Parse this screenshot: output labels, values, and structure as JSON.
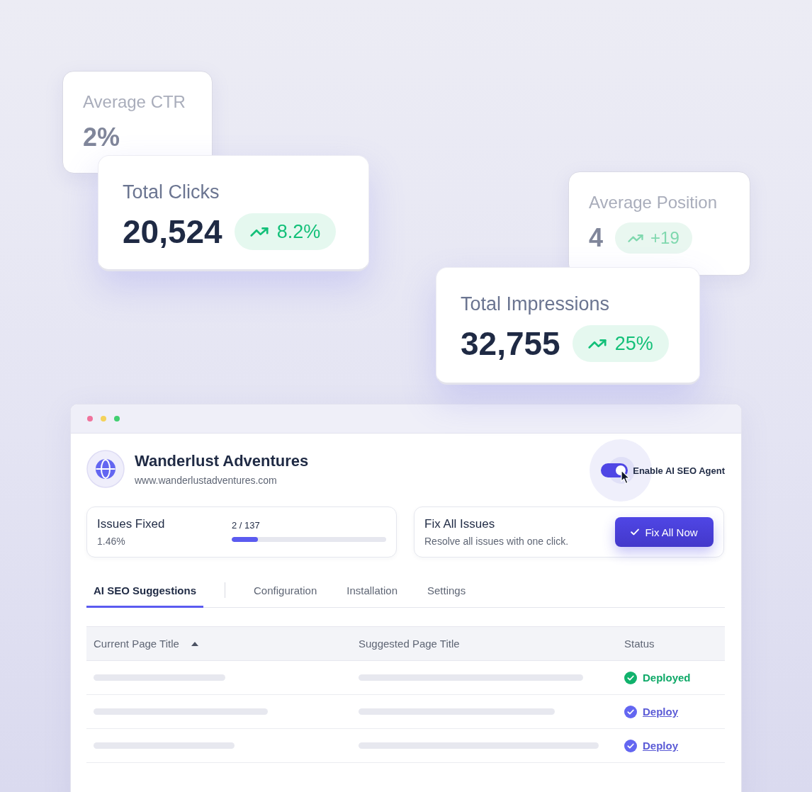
{
  "metrics": [
    {
      "label": "Average CTR",
      "value": "2%",
      "faded": true
    },
    {
      "label": "Total Clicks",
      "value": "20,524",
      "change": "8.2%",
      "rising": true,
      "faded": false
    },
    {
      "label": "Average Position",
      "value": "4",
      "change": "+19",
      "rising": true,
      "faded": true
    },
    {
      "label": "Total Impressions",
      "value": "32,755",
      "change": "25%",
      "rising": true,
      "faded": false
    }
  ],
  "site": {
    "name": "Wanderlust Adventures",
    "url": "www.wanderlustadventures.com"
  },
  "toggle": {
    "label": "Enable AI SEO Agent",
    "on": true
  },
  "issues_fixed": {
    "title": "Issues Fixed",
    "percent": "1.46%",
    "count": "2 / 137",
    "level": 0.17
  },
  "fix_all": {
    "title": "Fix All Issues",
    "description": "Resolve all issues with one click.",
    "button": "Fix All Now"
  },
  "tabs": [
    {
      "label": "AI SEO Suggestions",
      "selected": true,
      "separator_after": true
    },
    {
      "label": "Configuration",
      "selected": false,
      "separator_after": false
    },
    {
      "label": "Installation",
      "selected": false,
      "separator_after": false
    },
    {
      "label": "Settings",
      "selected": false,
      "separator_after": false
    }
  ],
  "table": {
    "columns": [
      {
        "label": "Current Page Title",
        "sorted": true
      },
      {
        "label": "Suggested Page Title",
        "sorted": false
      },
      {
        "label": "Status",
        "sorted": false
      }
    ],
    "rows": [
      {
        "status": {
          "kind": "deployed",
          "label": "Deployed"
        }
      },
      {
        "status": {
          "kind": "action",
          "label": "Deploy"
        }
      },
      {
        "status": {
          "kind": "action",
          "label": "Deploy"
        }
      }
    ]
  }
}
